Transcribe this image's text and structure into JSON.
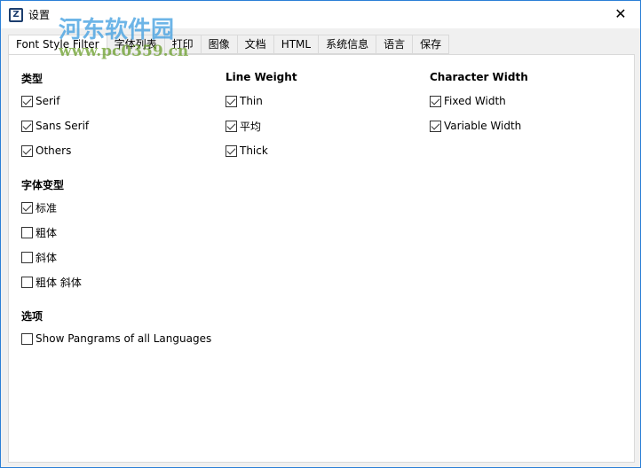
{
  "window": {
    "title": "设置",
    "close": "✕"
  },
  "tabs": [
    "Font Style Filter",
    "字体列表",
    "打印",
    "图像",
    "文档",
    "HTML",
    "系统信息",
    "语言",
    "保存"
  ],
  "groups": {
    "type": {
      "heading": "类型",
      "items": [
        {
          "label": "Serif",
          "checked": true
        },
        {
          "label": "Sans Serif",
          "checked": true
        },
        {
          "label": "Others",
          "checked": true
        }
      ]
    },
    "line_weight": {
      "heading": "Line Weight",
      "items": [
        {
          "label": "Thin",
          "checked": true
        },
        {
          "label": "平均",
          "checked": true
        },
        {
          "label": "Thick",
          "checked": true
        }
      ]
    },
    "char_width": {
      "heading": "Character Width",
      "items": [
        {
          "label": "Fixed Width",
          "checked": true
        },
        {
          "label": "Variable Width",
          "checked": true
        }
      ]
    },
    "variant": {
      "heading": "字体变型",
      "items": [
        {
          "label": "标准",
          "checked": true
        },
        {
          "label": "粗体",
          "checked": false
        },
        {
          "label": "斜体",
          "checked": false
        },
        {
          "label": "粗体 斜体",
          "checked": false
        }
      ]
    },
    "options": {
      "heading": "选项",
      "items": [
        {
          "label": "Show Pangrams of all Languages",
          "checked": false
        }
      ]
    }
  },
  "watermark": {
    "name": "河东软件园",
    "url": "www.pc0359.cn"
  }
}
